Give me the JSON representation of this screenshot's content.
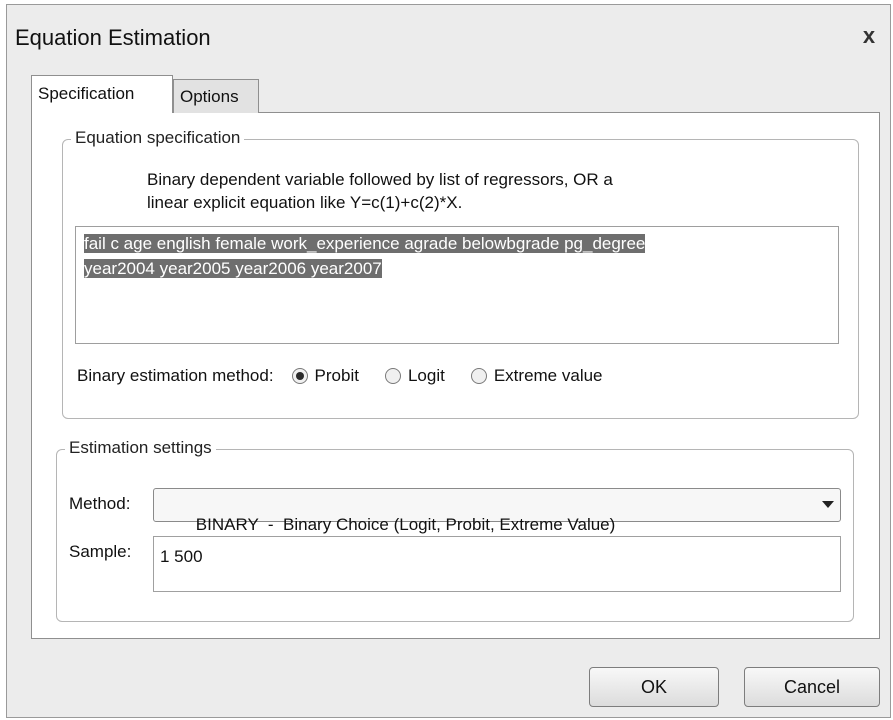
{
  "window": {
    "title": "Equation Estimation",
    "close_glyph": "x"
  },
  "tabs": [
    {
      "label": "Specification",
      "active": true
    },
    {
      "label": "Options",
      "active": false
    }
  ],
  "equation_spec": {
    "legend": "Equation specification",
    "instructions_line1": "Binary dependent variable followed by list of regressors, OR a",
    "instructions_line2": "linear explicit equation like Y=c(1)+c(2)*X.",
    "text_line1": "fail c age english female work_experience agrade belowbgrade pg_degree",
    "text_line2": "year2004 year2005 year2006 year2007",
    "binary_method_label": "Binary estimation method:",
    "methods": [
      {
        "label": "Probit",
        "checked": true
      },
      {
        "label": "Logit",
        "checked": false
      },
      {
        "label": "Extreme value",
        "checked": false
      }
    ]
  },
  "estimation_settings": {
    "legend": "Estimation settings",
    "method_label": "Method:",
    "method_value": "BINARY  -  Binary Choice (Logit, Probit, Extreme Value)",
    "sample_label": "Sample:",
    "sample_value": "1 500"
  },
  "buttons": {
    "ok": "OK",
    "cancel": "Cancel"
  }
}
